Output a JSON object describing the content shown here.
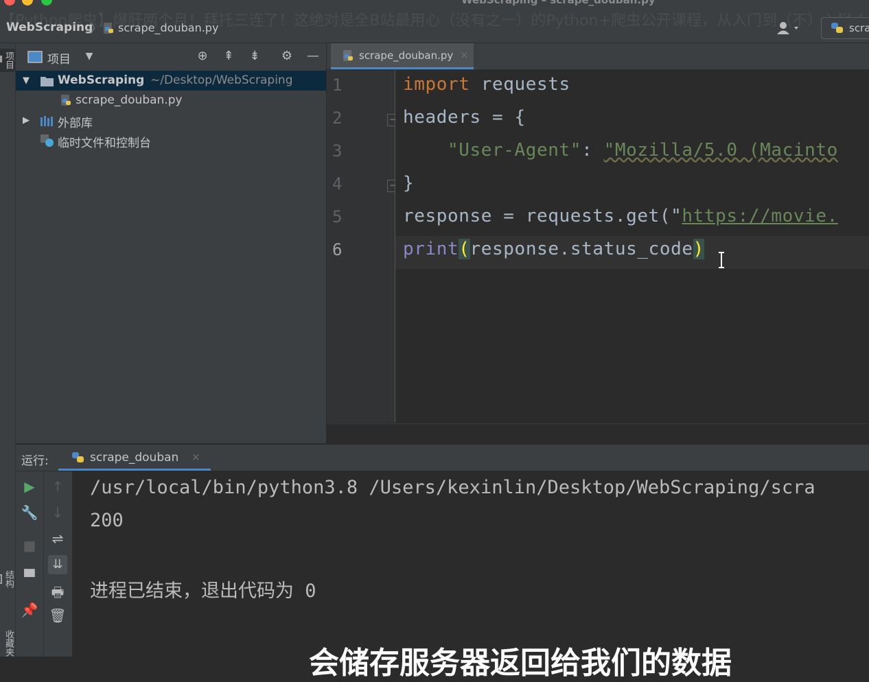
{
  "window": {
    "title": "WebScraping – scrape_douban.py",
    "banner": "【Python爬虫】爆肝两个月！拜托三连了！这绝对是全B站最用心（没有之一）的Python+爬虫公开课程，从入门到（不）入狱 ！",
    "traffic_lights": [
      "#ff5f57",
      "#febc2e",
      "#28c840"
    ]
  },
  "navbar": {
    "project": "WebScraping",
    "separator": "〉",
    "file": "scrape_douban.py",
    "run_config": "scra"
  },
  "left_strip": {
    "project_tab": "项目",
    "structure_tab": "结构",
    "favorites_tab": "收藏夹"
  },
  "project_panel": {
    "title": "项目",
    "tree": [
      {
        "name": "WebScraping",
        "path": "~/Desktop/WebScraping",
        "expanded": true,
        "selected": true
      },
      {
        "name": "scrape_douban.py"
      },
      {
        "name": "外部库",
        "expanded": false
      },
      {
        "name": "临时文件和控制台"
      }
    ]
  },
  "editor": {
    "tab_label": "scrape_douban.py",
    "close": "×",
    "line_numbers": [
      "1",
      "2",
      "3",
      "4",
      "5",
      "6"
    ],
    "lines": [
      {
        "kw": "import",
        "rest": " requests"
      },
      {
        "text": "headers = {"
      },
      {
        "indent": "    ",
        "key": "\"User-Agent\"",
        "colon": ": ",
        "val": "\"Mozilla/5.0 (Macinto"
      },
      {
        "text": "}"
      },
      {
        "pre": "response = requests.get(\"",
        "url": "https://movie."
      },
      {
        "fn": "print",
        "open": "(",
        "arg": "response.status_code",
        "close": ")"
      }
    ]
  },
  "run": {
    "label": "运行:",
    "tab": "scrape_douban",
    "close": "×",
    "console": [
      "/usr/local/bin/python3.8 /Users/kexinlin/Desktop/WebScraping/scra",
      "200",
      "",
      "进程已结束，退出代码为 0"
    ]
  },
  "subtitle": "会储存服务器返回给我们的数据"
}
